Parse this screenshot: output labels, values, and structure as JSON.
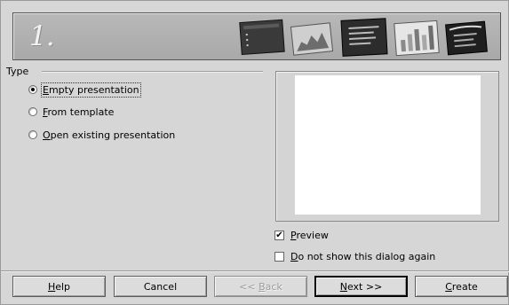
{
  "header": {
    "step_number": "1."
  },
  "type_group": {
    "label": "Type",
    "options": [
      {
        "label": "Empty presentation",
        "mnemonic": "E",
        "rest": "mpty presentation",
        "checked": true
      },
      {
        "label": "From template",
        "mnemonic": "F",
        "rest": "rom template",
        "checked": false
      },
      {
        "label": "Open existing presentation",
        "mnemonic": "O",
        "rest": "pen existing presentation",
        "checked": false
      }
    ]
  },
  "preview_checkbox": {
    "label": "Preview",
    "mnemonic": "P",
    "rest": "review",
    "checked": true
  },
  "dont_show_checkbox": {
    "label": "Do not show this dialog again",
    "mnemonic": "D",
    "rest": "o not show this dialog again",
    "checked": false
  },
  "buttons": {
    "help": {
      "mnemonic": "H",
      "rest": "elp"
    },
    "cancel": "Cancel",
    "back": {
      "prefix": "<< ",
      "mnemonic": "B",
      "rest": "ack"
    },
    "next": {
      "mnemonic": "N",
      "rest": "ext >>"
    },
    "create": {
      "mnemonic": "C",
      "rest": "reate"
    }
  },
  "icons": [
    "slide-dark-icon",
    "slide-chart-icon",
    "slide-list-icon",
    "slide-bar-chart-icon",
    "slide-dark-list-icon"
  ]
}
